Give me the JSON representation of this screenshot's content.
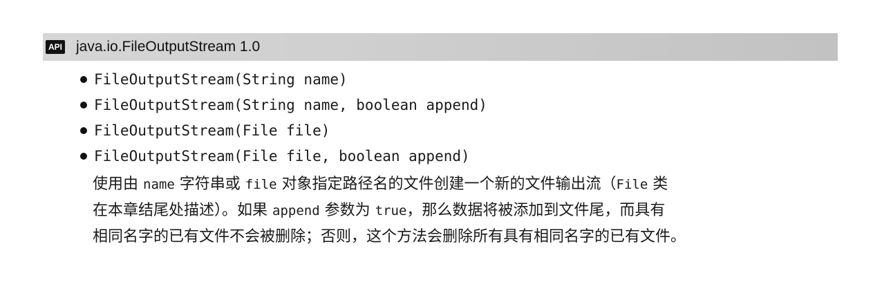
{
  "header": {
    "badge": "API",
    "title": "java.io.FileOutputStream 1.0"
  },
  "methods": [
    "FileOutputStream(String name)",
    "FileOutputStream(String name, boolean append)",
    "FileOutputStream(File file)",
    "FileOutputStream(File file, boolean append)"
  ],
  "description": {
    "line1": {
      "a": "使用由 ",
      "code1": "name",
      "b": " 字符串或 ",
      "code2": "file",
      "c": " 对象指定路径名的文件创建一个新的文件输出流（",
      "code3": "File",
      "d": " 类"
    },
    "line2": {
      "a": "在本章结尾处描述）。如果 ",
      "code1": "append",
      "b": " 参数为 ",
      "code2": "true",
      "c": "，那么数据将被添加到文件尾，而具有"
    },
    "line3": "相同名字的已有文件不会被删除；否则，这个方法会删除所有具有相同名字的已有文件。"
  }
}
